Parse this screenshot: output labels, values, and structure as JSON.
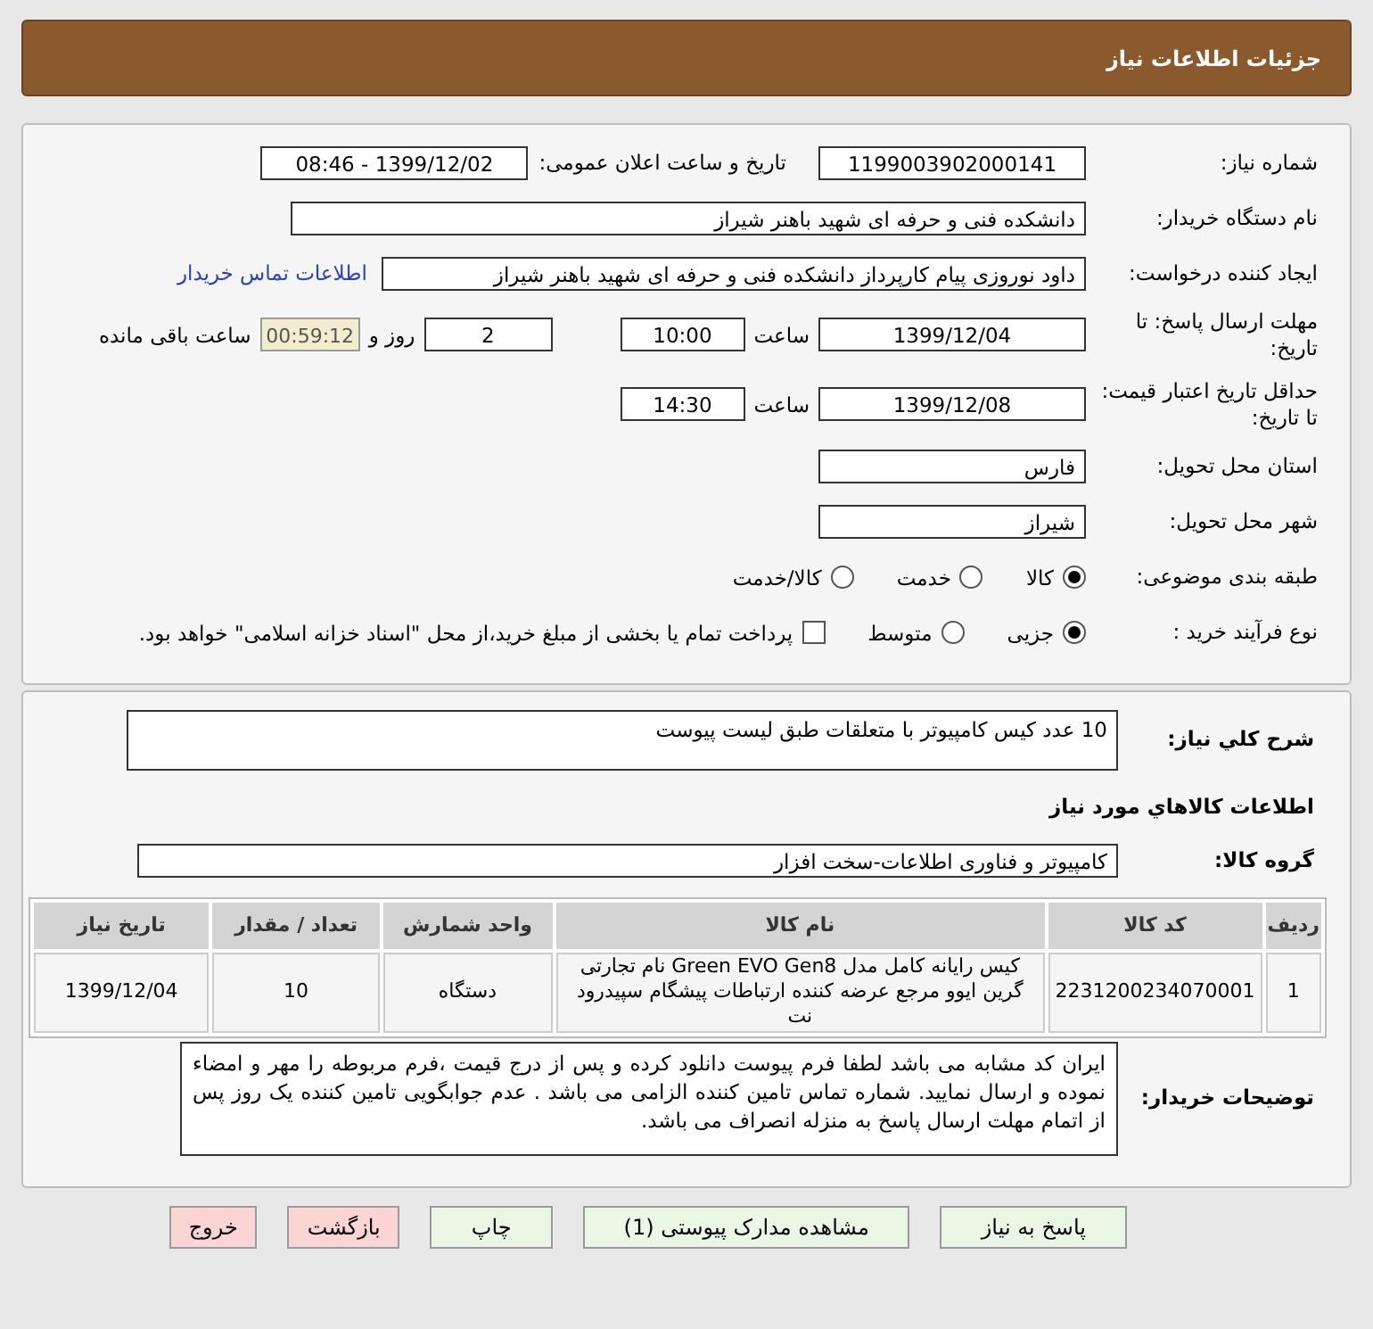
{
  "header": {
    "title": "جزئیات اطلاعات نیاز"
  },
  "details": {
    "need_number_label": "شماره نیاز:",
    "need_number": "1199003902000141",
    "announce_label": "تاریخ و ساعت اعلان عمومی:",
    "announce_value": "1399/12/02 - 08:46",
    "buyer_label": "نام دستگاه خریدار:",
    "buyer": "دانشکده فنی و حرفه ای شهید باهنر شیراز",
    "creator_label": "ایجاد کننده درخواست:",
    "creator": "داود نوروزی پیام کارپرداز دانشکده فنی و حرفه ای شهید باهنر شیراز",
    "contact_link": "اطلاعات تماس خریدار",
    "deadline_label": "مهلت ارسال پاسخ: تا تاریخ:",
    "deadline_date": "1399/12/04",
    "time_label": "ساعت",
    "deadline_time": "10:00",
    "days": "2",
    "days_label": "روز و",
    "remaining": "00:59:12",
    "remaining_label": "ساعت باقی مانده",
    "validity_label": "حداقل تاریخ اعتبار قیمت: تا تاریخ:",
    "validity_date": "1399/12/08",
    "validity_time_label": "ساعت",
    "validity_time": "14:30",
    "province_label": "استان محل تحویل:",
    "province": "فارس",
    "city_label": "شهر محل تحویل:",
    "city": "شیراز",
    "category_label": "طبقه بندی موضوعی:",
    "categories": [
      {
        "label": "کالا",
        "selected": true
      },
      {
        "label": "خدمت",
        "selected": false
      },
      {
        "label": "کالا/خدمت",
        "selected": false
      }
    ],
    "process_label": "نوع فرآیند خرید :",
    "processes": [
      {
        "label": "جزیی",
        "selected": true
      },
      {
        "label": "متوسط",
        "selected": false
      }
    ],
    "treasury": {
      "label": "پرداخت تمام یا بخشی از مبلغ خرید،از محل \"اسناد خزانه اسلامی\" خواهد بود.",
      "checked": false
    }
  },
  "summary": {
    "description_label": "شرح کلي نياز:",
    "description": "10 عدد کیس کامپیوتر با متعلقات طبق لیست پیوست",
    "goods_heading": "اطلاعات کالاهاي مورد نياز",
    "group_label": "گروه کالا:",
    "group": "کامپیوتر و فناوری اطلاعات-سخت افزار",
    "table": {
      "columns": [
        "ردیف",
        "کد کالا",
        "نام کالا",
        "واحد شمارش",
        "تعداد / مقدار",
        "تاریخ نیاز"
      ],
      "rows": [
        [
          "1",
          "2231200234070001",
          "کیس رایانه کامل مدل Green EVO Gen8 نام تجارتی گرین ایوو مرجع عرضه کننده ارتباطات پیشگام سپیدرود نت",
          "دستگاه",
          "10",
          "1399/12/04"
        ]
      ]
    },
    "notes_label": "توضیحات خریدار:",
    "notes": "ایران کد مشابه می باشد لطفا  فرم پیوست  دانلود کرده و پس از درج قیمت ،فرم مربوطه را مهر و امضاء نموده و ارسال نمایید. شماره تماس تامین کننده الزامی می باشد . عدم جوابگویی تامین کننده یک روز پس از اتمام مهلت  ارسال پاسخ به منزله انصراف می باشد."
  },
  "buttons": [
    {
      "label": "پاسخ به نیاز",
      "kind": "normal"
    },
    {
      "label": "مشاهده مدارک پیوستی (1)",
      "kind": "normal"
    },
    {
      "label": "چاپ",
      "kind": "normal"
    },
    {
      "label": "بازگشت",
      "kind": "exit"
    },
    {
      "label": "خروج",
      "kind": "exit"
    }
  ]
}
